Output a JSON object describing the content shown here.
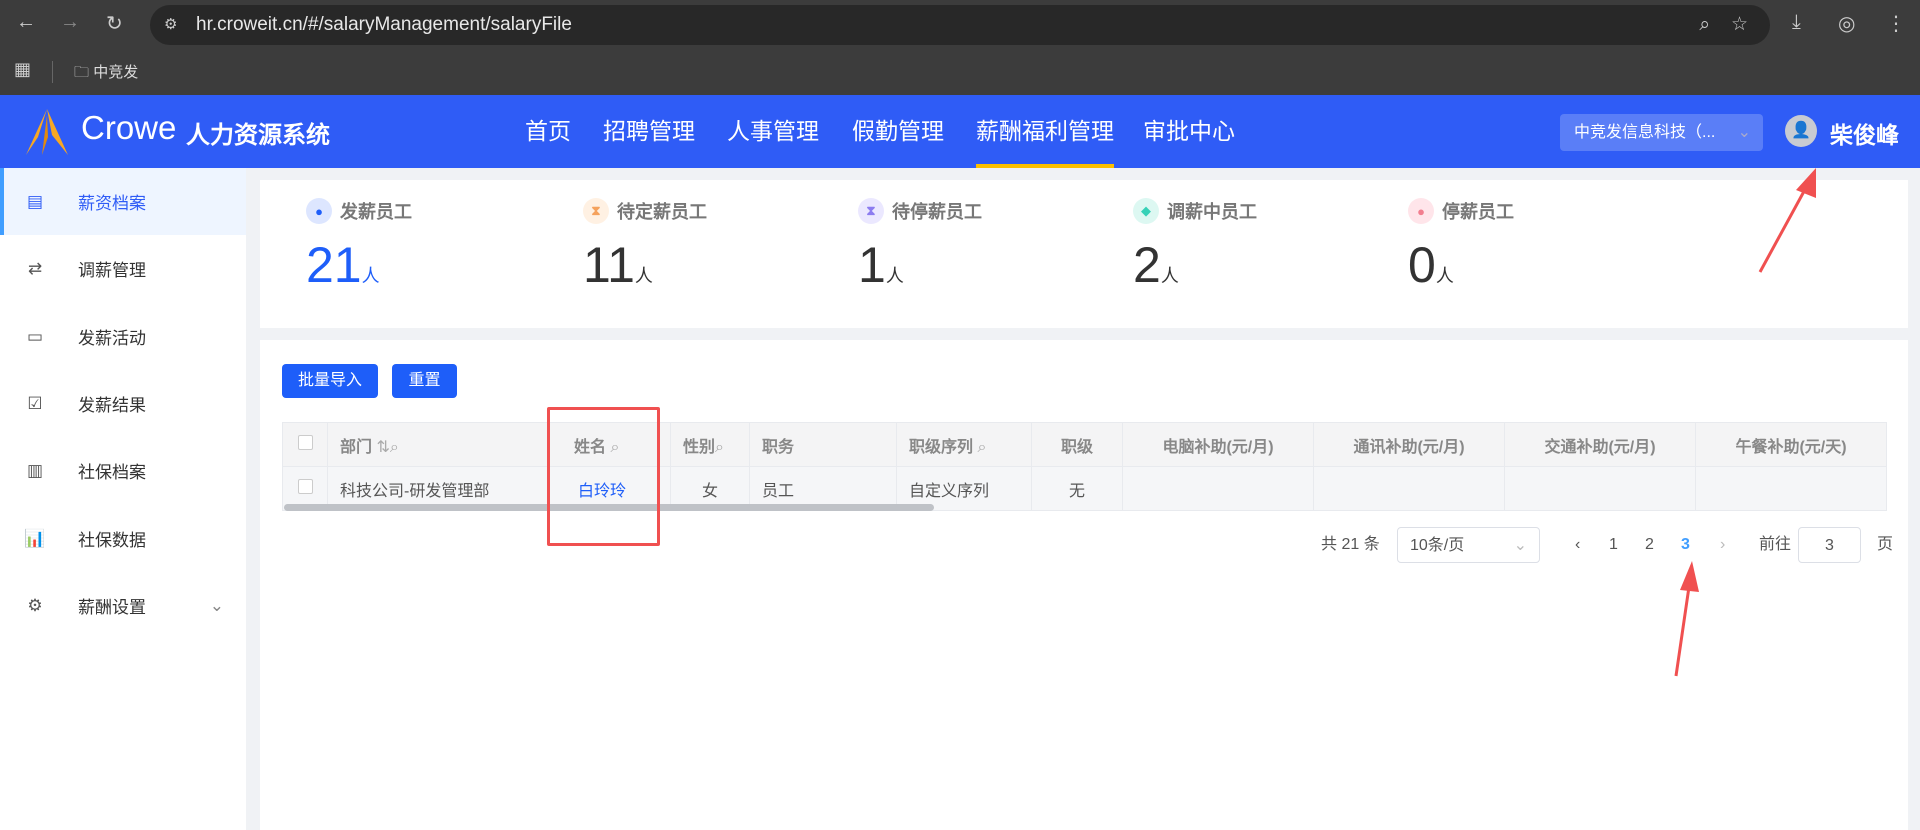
{
  "browser": {
    "url": "hr.croweit.cn/#/salaryManagement/salaryFile",
    "bookmark": "中竞发"
  },
  "header": {
    "logo_text": "Crowe",
    "system_name": "人力资源系统",
    "nav": [
      "首页",
      "招聘管理",
      "人事管理",
      "假勤管理",
      "薪酬福利管理",
      "审批中心"
    ],
    "active_nav": "薪酬福利管理",
    "company": "中竞发信息科技（...",
    "user": "柴俊峰"
  },
  "sidebar": {
    "items": [
      {
        "label": "薪资档案",
        "icon": "document-icon"
      },
      {
        "label": "调薪管理",
        "icon": "exchange-icon"
      },
      {
        "label": "发薪活动",
        "icon": "clipboard-icon"
      },
      {
        "label": "发薪结果",
        "icon": "clipboard-check-icon"
      },
      {
        "label": "社保档案",
        "icon": "files-icon"
      },
      {
        "label": "社保数据",
        "icon": "bar-chart-icon"
      },
      {
        "label": "薪酬设置",
        "icon": "gear-icon"
      }
    ]
  },
  "stats": [
    {
      "label": "发薪员工",
      "value": "21",
      "unit": "人",
      "color": "#1e5ef9"
    },
    {
      "label": "待定薪员工",
      "value": "11",
      "unit": "人",
      "color": "#f5a25d"
    },
    {
      "label": "待停薪员工",
      "value": "1",
      "unit": "人",
      "color": "#8c7cf0"
    },
    {
      "label": "调薪中员工",
      "value": "2",
      "unit": "人",
      "color": "#36d1b7"
    },
    {
      "label": "停薪员工",
      "value": "0",
      "unit": "人",
      "color": "#f27e8f"
    }
  ],
  "toolbar": {
    "import": "批量导入",
    "reset": "重置"
  },
  "table": {
    "headers": [
      "部门",
      "姓名",
      "性别",
      "职务",
      "职级序列",
      "职级",
      "电脑补助(元/月)",
      "通讯补助(元/月)",
      "交通补助(元/月)",
      "午餐补助(元/天)"
    ],
    "rows": [
      [
        "科技公司-研发管理部",
        "白玲玲",
        "女",
        "员工",
        "自定义序列",
        "无",
        "",
        "",
        "",
        ""
      ]
    ]
  },
  "pagination": {
    "total": "共 21 条",
    "page_size": "10条/页",
    "pages": [
      "1",
      "2",
      "3"
    ],
    "current": "3",
    "goto_label": "前往",
    "goto_value": "3",
    "page_suffix": "页"
  }
}
